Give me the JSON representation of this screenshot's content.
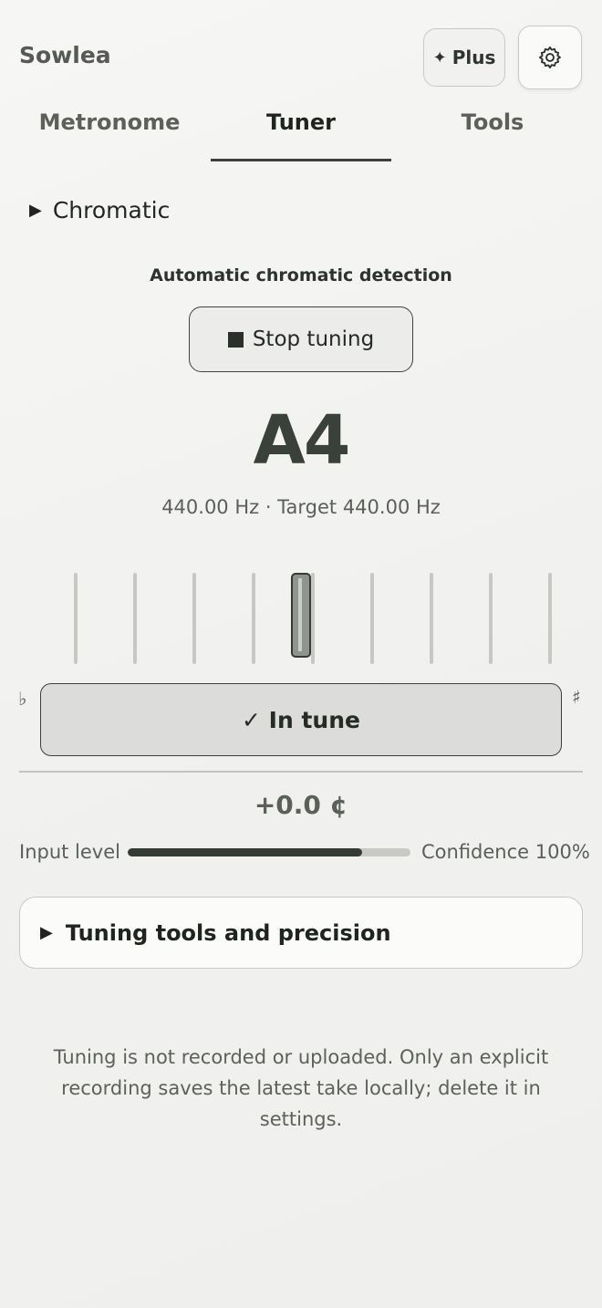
{
  "header": {
    "brand": "Sowlea",
    "plus_label": "Plus",
    "plus_icon": "sparkle-icon",
    "settings_icon": "gear-icon"
  },
  "tabs": [
    {
      "label": "Metronome",
      "active": false
    },
    {
      "label": "Tuner",
      "active": true
    },
    {
      "label": "Tools",
      "active": false
    }
  ],
  "tuner": {
    "mode_label": "Chromatic",
    "auto_label": "Automatic chromatic detection",
    "stop_label": "Stop tuning",
    "note": "A4",
    "freq_text": "440.00 Hz · Target 440.00 Hz",
    "flat_symbol": "♭",
    "sharp_symbol": "♯",
    "status": "✓ In tune",
    "cents": "+0.0 ¢",
    "input_level_label": "Input level",
    "input_level": 0.83,
    "confidence_text": "Confidence 100%"
  },
  "tools_section": {
    "label": "Tuning tools and precision"
  },
  "privacy_note": "Tuning is not recorded or uploaded. Only an explicit recording saves the latest take locally; delete it in settings.",
  "colors": {
    "accent": "#353b35",
    "track": "#c9cac6",
    "status_bg": "#dcdcda"
  }
}
